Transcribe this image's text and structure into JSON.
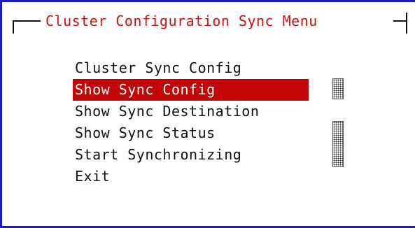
{
  "dialog": {
    "title": "Cluster Configuration Sync Menu"
  },
  "menu": {
    "items": [
      {
        "label": "Cluster Sync Config",
        "selected": false
      },
      {
        "label": "Show Sync Config",
        "selected": true
      },
      {
        "label": "Show Sync Destination",
        "selected": false
      },
      {
        "label": "Show Sync Status",
        "selected": false
      },
      {
        "label": "Start Synchronizing",
        "selected": false
      },
      {
        "label": "Exit",
        "selected": false
      }
    ]
  },
  "colors": {
    "title_text": "#cc1111",
    "selection_background": "#c40505",
    "selection_text": "#ffffff",
    "item_text": "#111111",
    "window_edge": "#1b1bc8"
  },
  "icons": {
    "scroll_indicator": "shaded-block"
  }
}
